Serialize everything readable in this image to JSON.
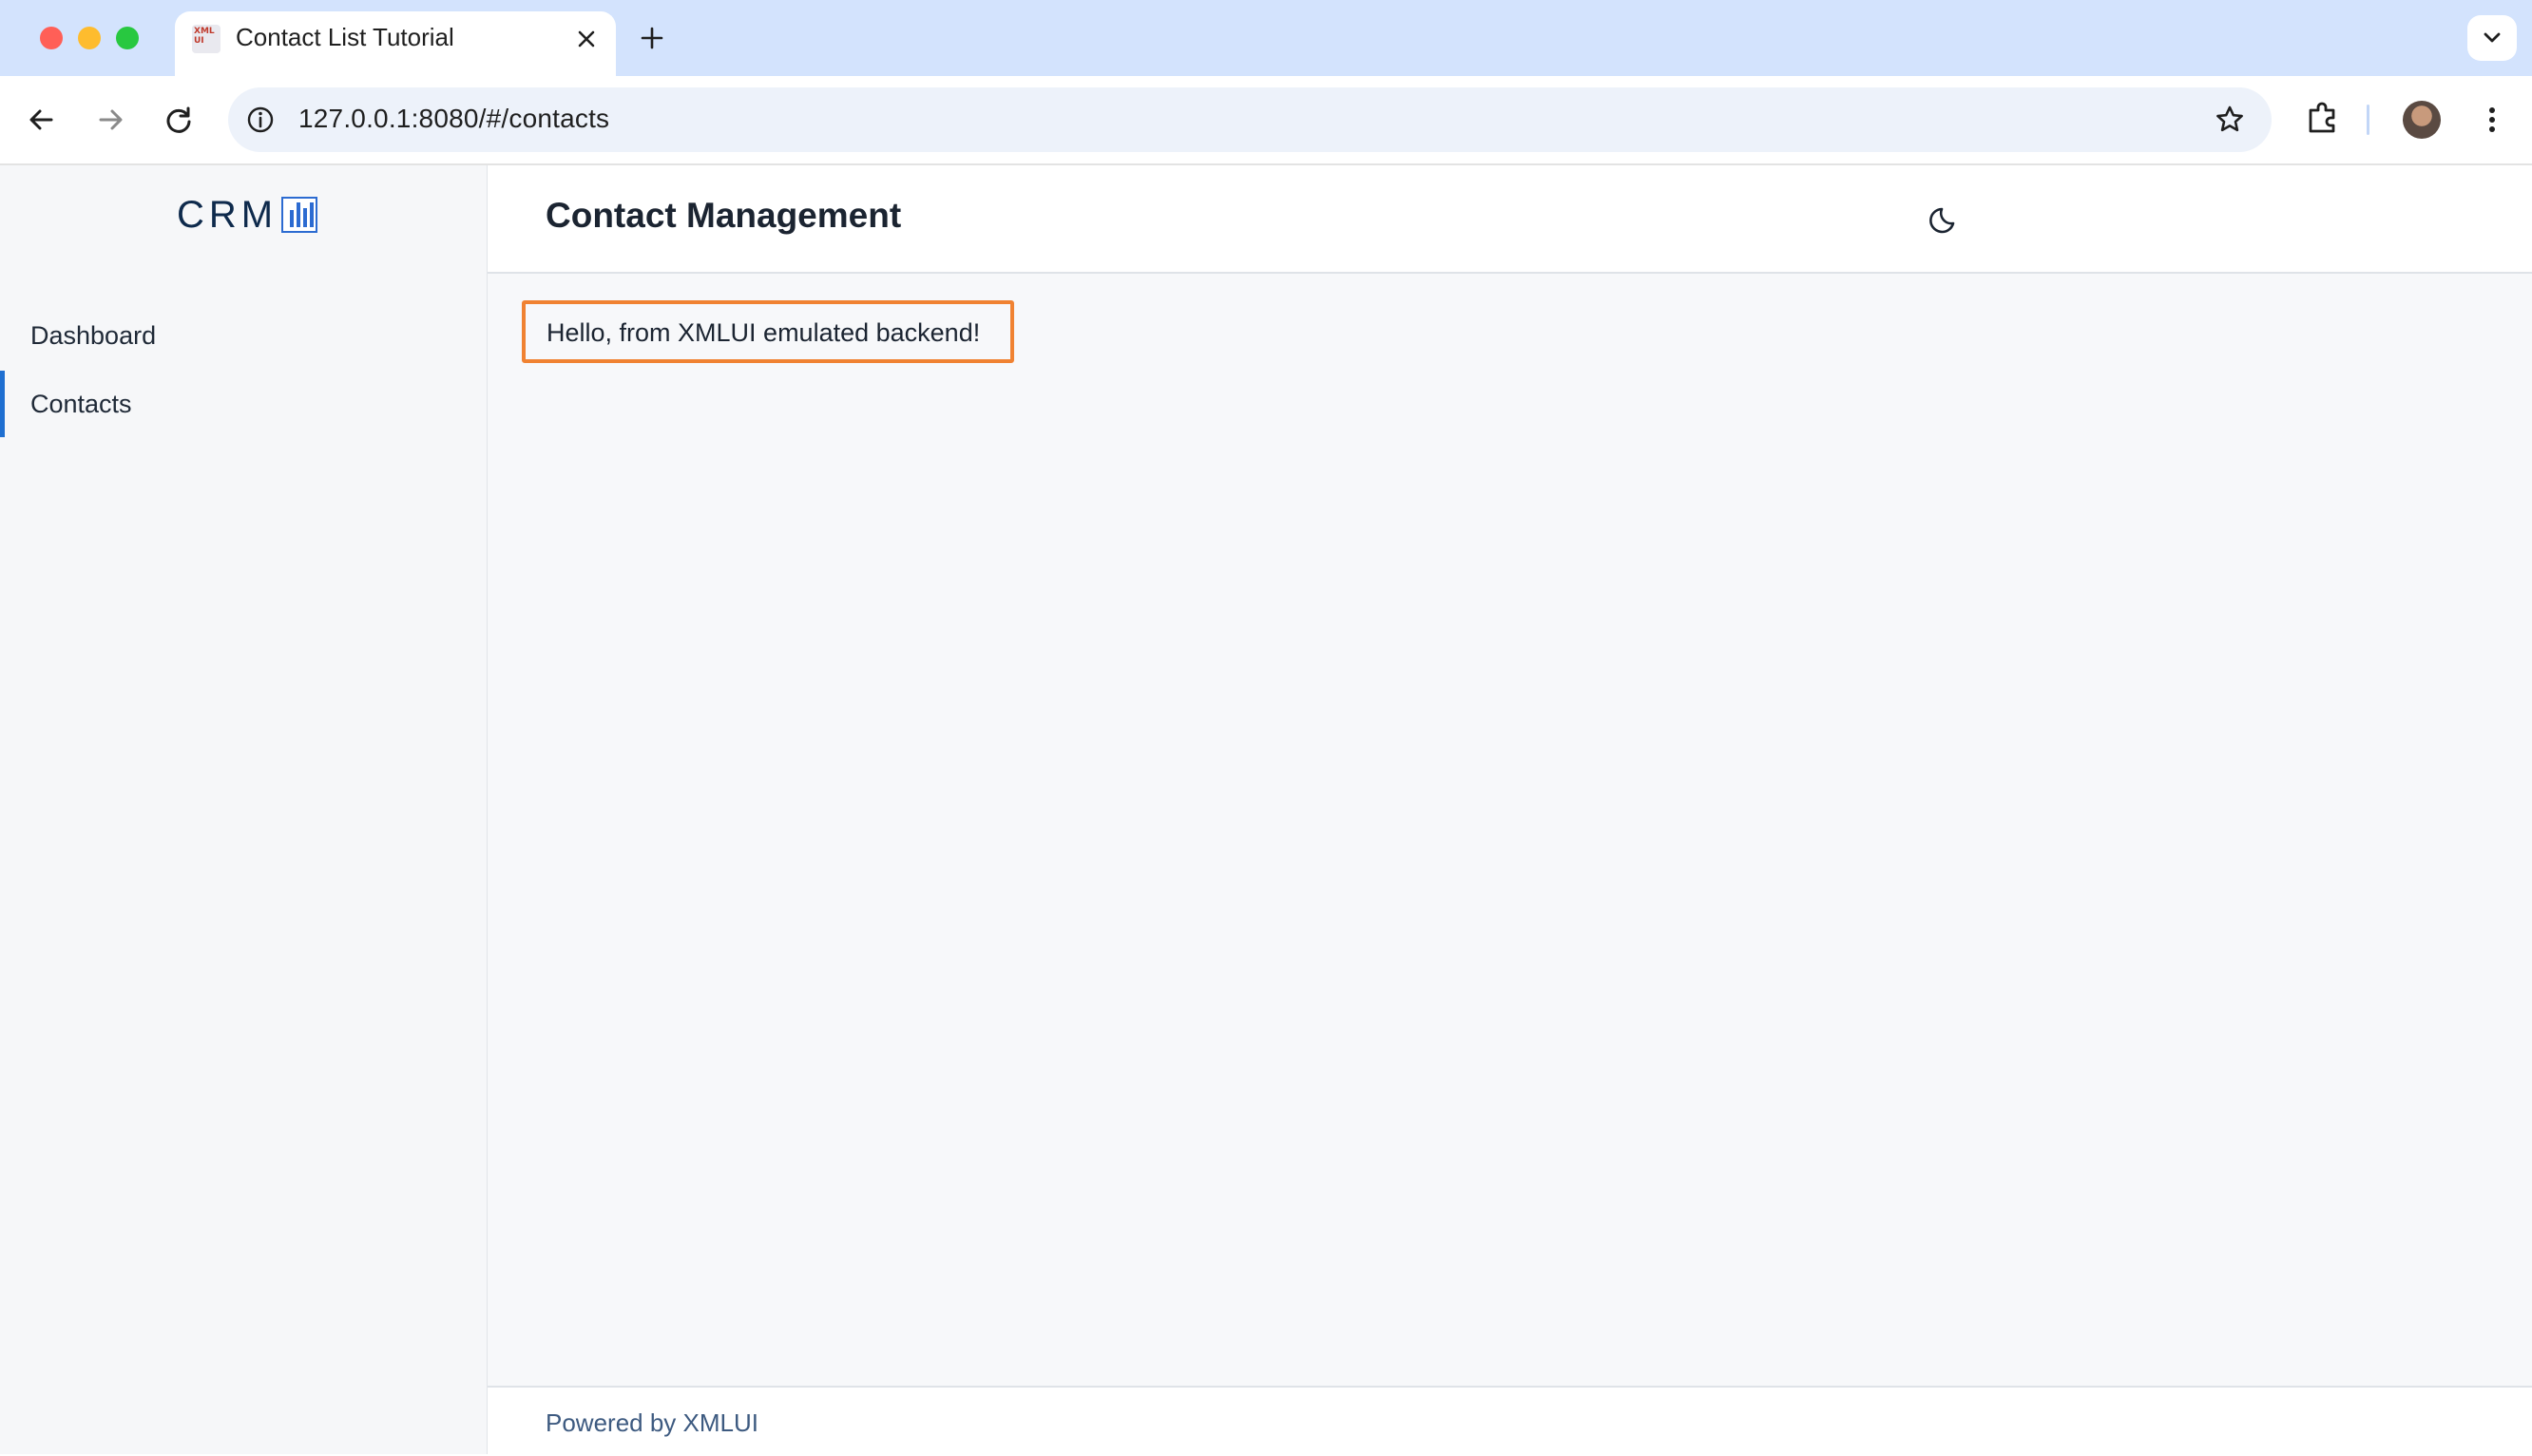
{
  "browser": {
    "tab_title": "Contact List Tutorial",
    "tab_favicon_text": "XML UI",
    "url": "127.0.0.1:8080/#/contacts"
  },
  "app": {
    "logo_text": "CRM",
    "header_title": "Contact Management",
    "nav": [
      {
        "label": "Dashboard",
        "active": false
      },
      {
        "label": "Contacts",
        "active": true
      }
    ],
    "message": "Hello, from XMLUI emulated backend!",
    "footer": "Powered by XMLUI",
    "colors": {
      "accent": "#1f6fd1",
      "highlight_border": "#f08232"
    }
  }
}
